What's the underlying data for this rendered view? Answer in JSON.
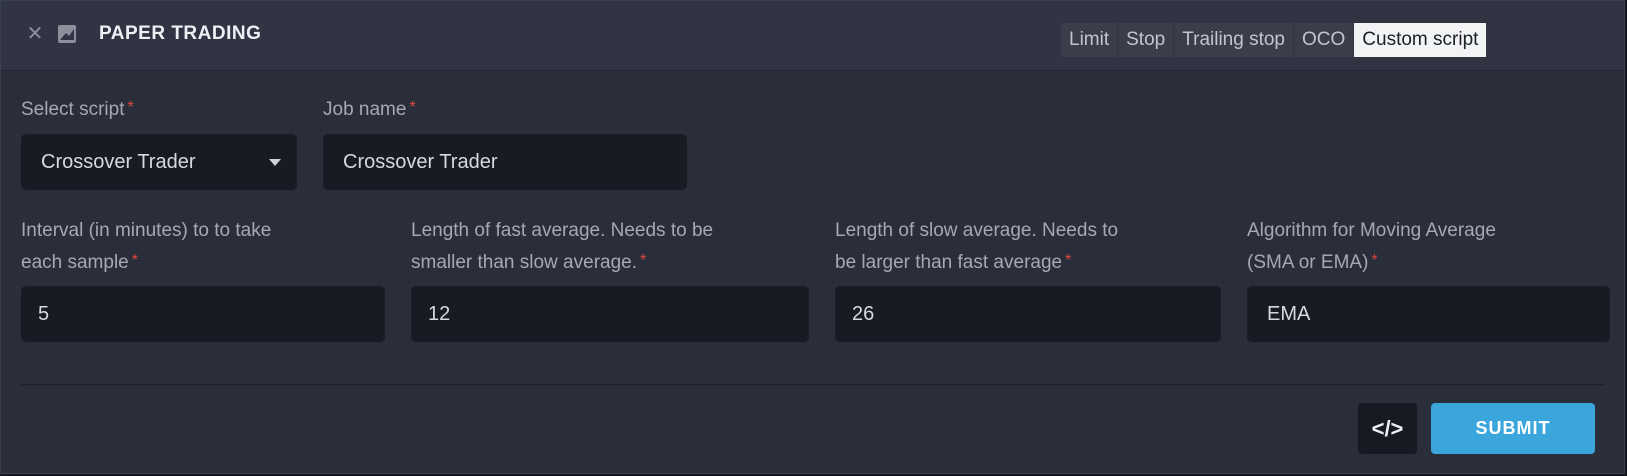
{
  "header": {
    "title": "PAPER TRADING",
    "close_icon": "✕",
    "image_icon": "image-icon"
  },
  "tabs": [
    {
      "label": "Limit",
      "active": false
    },
    {
      "label": "Stop",
      "active": false
    },
    {
      "label": "Trailing stop",
      "active": false
    },
    {
      "label": "OCO",
      "active": false
    },
    {
      "label": "Custom script",
      "active": true
    }
  ],
  "form": {
    "required_marker": "*",
    "select_script": {
      "label": "Select script",
      "value": "Crossover Trader"
    },
    "job_name": {
      "label": "Job name",
      "value": "Crossover Trader"
    },
    "interval": {
      "label_line1": "Interval (in minutes) to to take",
      "label_line2": "each sample",
      "value": "5"
    },
    "fast_average": {
      "label_line1": "Length of fast average. Needs to be",
      "label_line2": "smaller than slow average.",
      "value": "12"
    },
    "slow_average": {
      "label_line1": "Length of slow average. Needs to",
      "label_line2": "be larger than fast average",
      "value": "26"
    },
    "algorithm": {
      "label_line1": "Algorithm for Moving Average",
      "label_line2": "(SMA or EMA)",
      "value": "EMA"
    }
  },
  "footer": {
    "code_button_label": "</>",
    "submit_label": "SUBMIT"
  },
  "colors": {
    "accent": "#3aa6dc",
    "required": "#e0463c",
    "panel_bg": "#2a2e3b",
    "field_bg": "#181b23"
  }
}
